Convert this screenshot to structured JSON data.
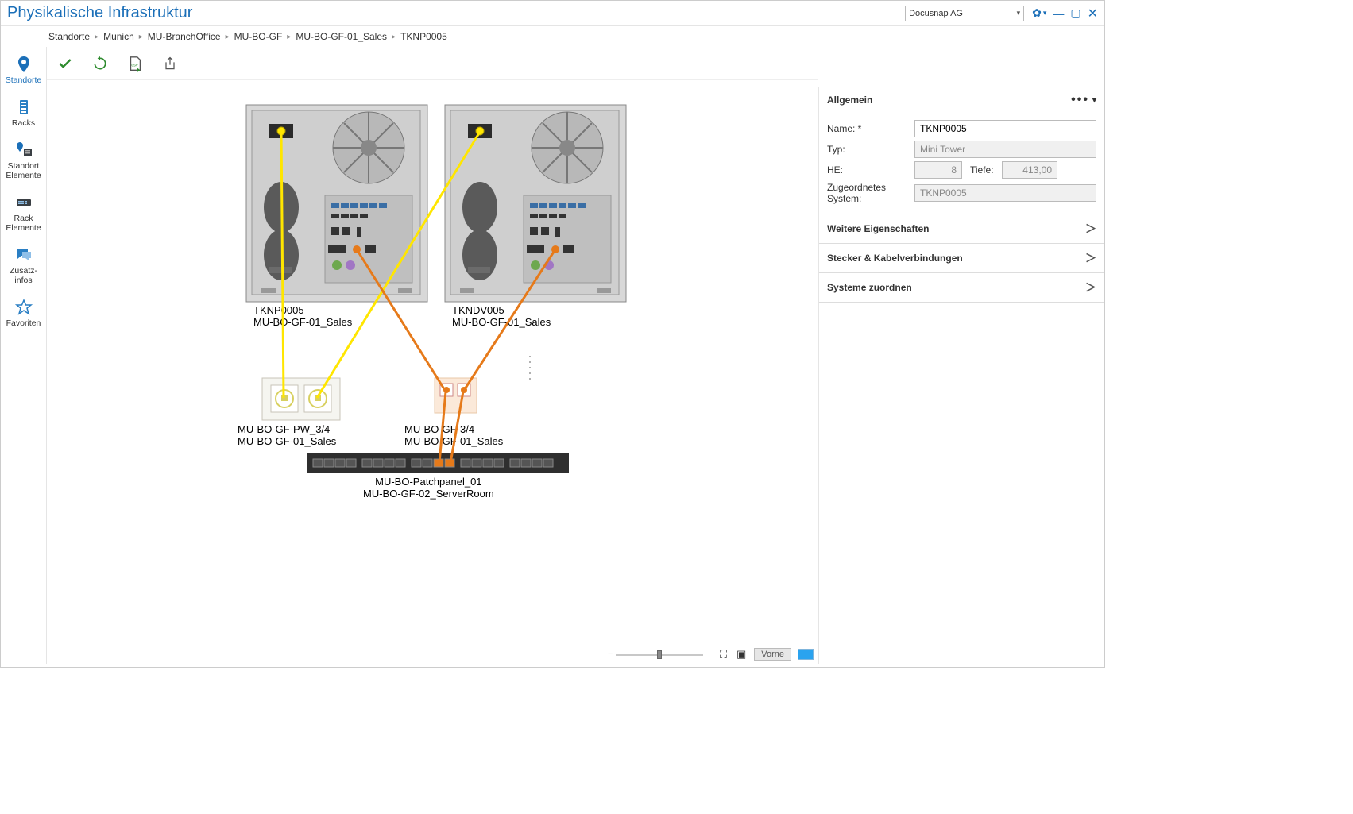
{
  "app": {
    "title": "Physikalische Infrastruktur",
    "org": "Docusnap AG"
  },
  "breadcrumb": [
    "Standorte",
    "Munich",
    "MU-BranchOffice",
    "MU-BO-GF",
    "MU-BO-GF-01_Sales",
    "TKNP0005"
  ],
  "sidebar": {
    "items": [
      {
        "label": "Standorte",
        "icon": "location"
      },
      {
        "label": "Racks",
        "icon": "rack"
      },
      {
        "label": "Standort Elemente",
        "icon": "location-rack"
      },
      {
        "label": "Rack Elemente",
        "icon": "rack-elem"
      },
      {
        "label": "Zusatz-infos",
        "icon": "bubble"
      },
      {
        "label": "Favoriten",
        "icon": "star"
      }
    ]
  },
  "toolbar": {
    "apply": "Übernehmen",
    "refresh": "Aktualisieren",
    "export_csv": "CSV exportieren",
    "share": "Teilen"
  },
  "props": {
    "general_header": "Allgemein",
    "name_label": "Name: *",
    "name_value": "TKNP0005",
    "type_label": "Typ:",
    "type_value": "Mini Tower",
    "he_label": "HE:",
    "he_value": "8",
    "depth_label": "Tiefe:",
    "depth_value": "413,00",
    "assigned_label": "Zugeordnetes System:",
    "assigned_value": "TKNP0005",
    "more_props": "Weitere Eigenschaften",
    "connectors": "Stecker & Kabelverbindungen",
    "assign_systems": "Systeme zuordnen"
  },
  "diagram": {
    "pc1": {
      "name": "TKNP0005",
      "loc": "MU-BO-GF-01_Sales"
    },
    "pc2": {
      "name": "TKNDV005",
      "loc": "MU-BO-GF-01_Sales"
    },
    "jack1": {
      "name": "MU-BO-GF-PW_3/4",
      "loc": "MU-BO-GF-01_Sales"
    },
    "jack2": {
      "name": "MU-BO-GF-3/4",
      "loc": "MU-BO-GF-01_Sales"
    },
    "patch": {
      "name": "MU-BO-Patchpanel_01",
      "loc": "MU-BO-GF-02_ServerRoom"
    }
  },
  "bottom": {
    "front": "Vorne"
  }
}
